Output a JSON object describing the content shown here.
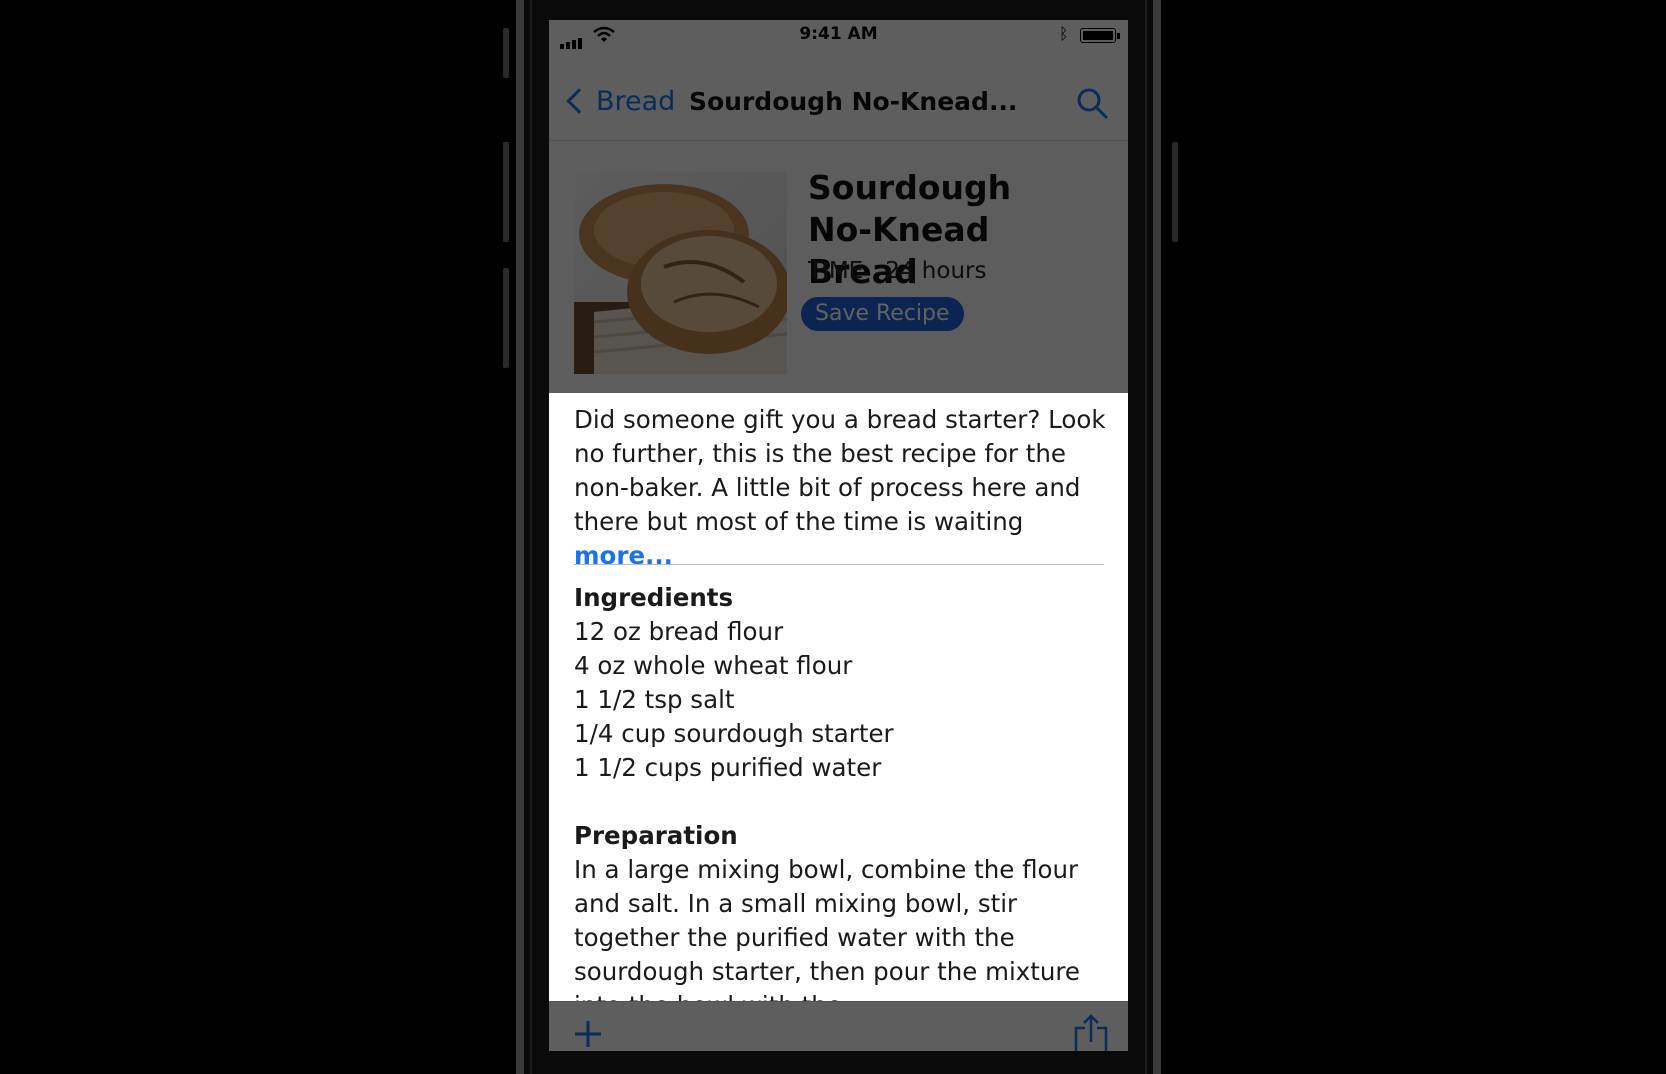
{
  "status_bar": {
    "time": "9:41 AM",
    "icons": [
      "cellular-signal-icon",
      "wifi-icon",
      "bluetooth-icon",
      "battery-icon"
    ]
  },
  "nav": {
    "back_label": "Bread",
    "title": "Sourdough No-Knead...",
    "search_icon": "search-icon"
  },
  "recipe": {
    "title_line1": "Sourdough",
    "title_line2": "No-Knead Bread",
    "time_label": "TIME",
    "time_value": "24 hours",
    "save_label": "Save Recipe",
    "photo": "bread-loaves-photo"
  },
  "intro": {
    "text": "Did someone gift you a bread starter? Look no further, this is the best recipe for the non-baker. A little bit of process here and there but most of the time is waiting ",
    "more_label": "more..."
  },
  "ingredients": {
    "heading": "Ingredients",
    "items": [
      "12 oz bread flour",
      "4 oz whole wheat flour",
      "1 1/2 tsp salt",
      "1/4 cup sourdough starter",
      "1 1/2 cups purified water"
    ]
  },
  "preparation": {
    "heading": "Preparation",
    "text": "In a large mixing bowl, combine the flour and salt. In a small mixing bowl, stir together the purified water with the sourdough starter, then pour the mixture into the bowl with the"
  },
  "toolbar": {
    "add_icon": "plus-icon",
    "share_icon": "share-icon"
  },
  "colors": {
    "accent": "#1a73e8",
    "save_button": "#1f5fd6"
  }
}
